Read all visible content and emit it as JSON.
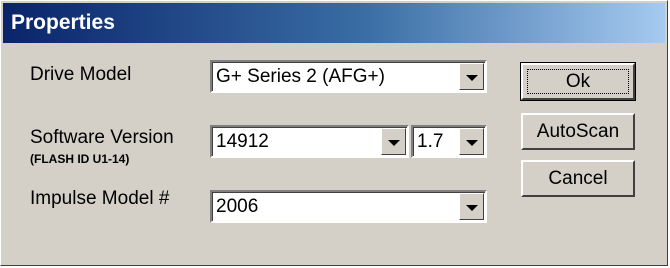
{
  "dialog": {
    "title": "Properties"
  },
  "form": {
    "drive_model": {
      "label": "Drive Model",
      "value": "G+ Series 2 (AFG+)"
    },
    "software_version": {
      "label": "Software Version",
      "sublabel": "(FLASH ID U1-14)",
      "value": "14912",
      "revision": "1.7"
    },
    "impulse_model": {
      "label": "Impulse Model #",
      "value": "2006"
    }
  },
  "buttons": {
    "ok": "Ok",
    "autoscan": "AutoScan",
    "cancel": "Cancel"
  },
  "icons": {
    "dropdown": "chevron-down-icon"
  },
  "colors": {
    "title_start": "#0a246a",
    "title_end": "#a6caf0",
    "face": "#d4d0c8"
  }
}
